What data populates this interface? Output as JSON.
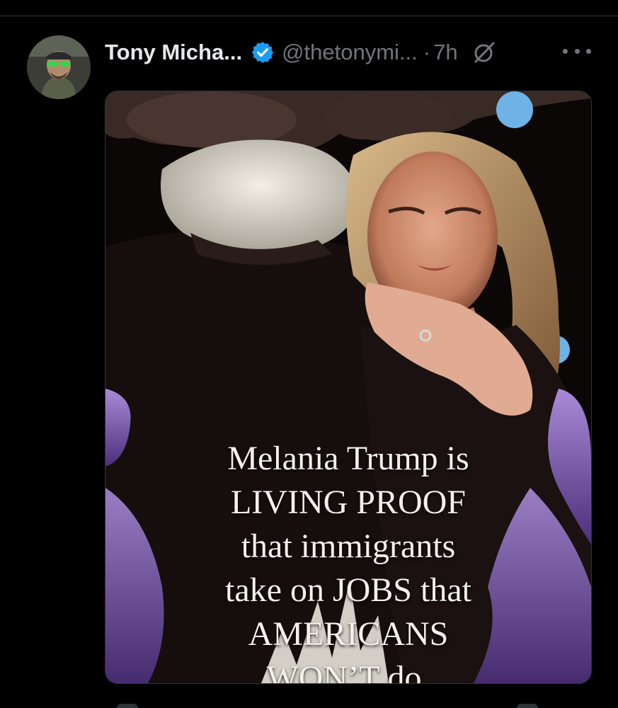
{
  "tweet": {
    "display_name": "Tony Micha...",
    "handle": "@thetonymi...",
    "separator": "·",
    "timestamp": "7h",
    "verified": true
  },
  "icons": {
    "verified": "verified-badge-icon",
    "grok": "grok-icon",
    "more": "more-options-icon"
  },
  "colors": {
    "background": "#000000",
    "verified_blue": "#1d9bf0",
    "secondary_text": "#71767b",
    "primary_text": "#e7e9ea"
  },
  "media": {
    "caption_lines": [
      "Melania Trump is",
      "LIVING PROOF",
      "that immigrants",
      "take on JOBS that",
      "AMERICANS",
      "WON’T do."
    ]
  }
}
